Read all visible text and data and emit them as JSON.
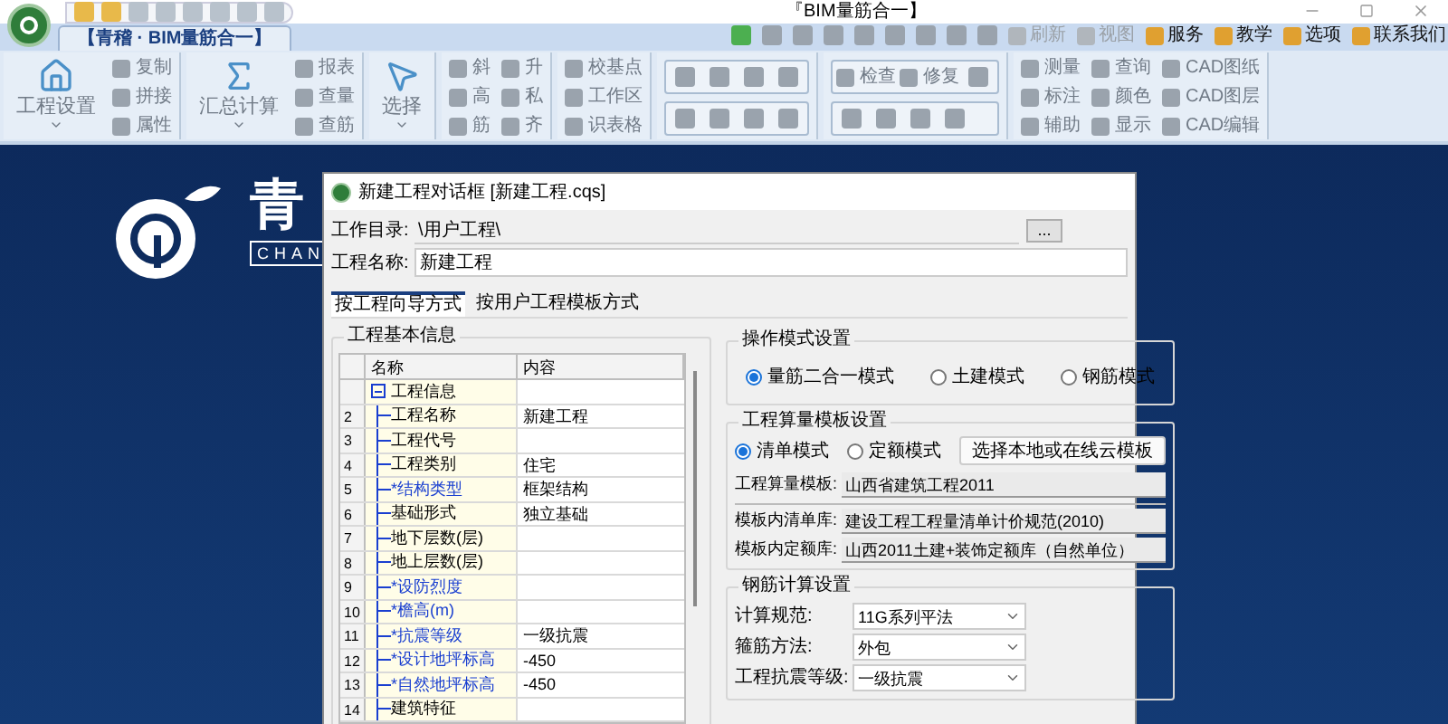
{
  "window": {
    "title": "『BIM量筋合一】"
  },
  "tabs": [
    {
      "label": "【青稽 · BIM量筋合一】",
      "selected": true
    }
  ],
  "toolbar": [
    {
      "label": "刷新",
      "disabled": true
    },
    {
      "label": "视图",
      "disabled": true
    },
    {
      "label": "服务",
      "disabled": false
    },
    {
      "label": "教学",
      "disabled": false
    },
    {
      "label": "选项",
      "disabled": false
    },
    {
      "label": "联系我们",
      "disabled": false
    }
  ],
  "ribbon": [
    {
      "kind": "columns",
      "columns": [
        [
          {
            "kind": "large",
            "label": "工程设置"
          }
        ],
        [
          {
            "kind": "small",
            "label": "复制"
          },
          {
            "kind": "small",
            "label": "拼接"
          },
          {
            "kind": "small",
            "label": "属性"
          }
        ]
      ]
    },
    {
      "kind": "columns",
      "columns": [
        [
          {
            "kind": "large",
            "label": "汇总计算"
          }
        ],
        [
          {
            "kind": "small",
            "label": "报表"
          },
          {
            "kind": "small",
            "label": "查量"
          },
          {
            "kind": "small",
            "label": "查筋"
          }
        ]
      ]
    },
    {
      "kind": "columns",
      "columns": [
        [
          {
            "kind": "large",
            "label": "选择"
          }
        ]
      ]
    },
    {
      "kind": "columns",
      "columns": [
        [
          {
            "kind": "small",
            "label": "斜"
          },
          {
            "kind": "small",
            "label": "高"
          },
          {
            "kind": "small",
            "label": "筋"
          }
        ],
        [
          {
            "kind": "small",
            "label": "升"
          },
          {
            "kind": "small",
            "label": "私"
          },
          {
            "kind": "small",
            "label": "齐"
          }
        ]
      ]
    },
    {
      "kind": "columns",
      "columns": [
        [
          {
            "kind": "small",
            "label": "校基点"
          },
          {
            "kind": "small",
            "label": "工作区"
          },
          {
            "kind": "small",
            "label": "识表格"
          }
        ]
      ]
    },
    {
      "kind": "rows",
      "rows": [
        [
          {
            "kind": "icon"
          },
          {
            "kind": "icon"
          },
          {
            "kind": "icon"
          },
          {
            "kind": "icon"
          }
        ],
        [
          {
            "kind": "icon"
          },
          {
            "kind": "icon"
          },
          {
            "kind": "icon"
          },
          {
            "kind": "icon"
          }
        ]
      ]
    },
    {
      "kind": "rows",
      "rows": [
        [
          {
            "kind": "small",
            "label": "检查"
          },
          {
            "kind": "small",
            "label": "修复"
          },
          {
            "kind": "icon"
          }
        ],
        [
          {
            "kind": "icon"
          },
          {
            "kind": "icon"
          },
          {
            "kind": "icon"
          },
          {
            "kind": "icon"
          }
        ]
      ]
    },
    {
      "kind": "columns",
      "columns": [
        [
          {
            "kind": "small",
            "label": "测量"
          },
          {
            "kind": "small",
            "label": "标注"
          },
          {
            "kind": "small",
            "label": "辅助"
          }
        ],
        [
          {
            "kind": "small",
            "label": "查询"
          },
          {
            "kind": "small",
            "label": "颜色"
          },
          {
            "kind": "small",
            "label": "显示"
          }
        ],
        [
          {
            "kind": "small",
            "label": "CAD图纸"
          },
          {
            "kind": "small",
            "label": "CAD图层"
          },
          {
            "kind": "small",
            "label": "CAD编辑"
          }
        ]
      ]
    }
  ],
  "background": {
    "logo_text": "青",
    "logo_subtext": "CHAN"
  },
  "dialog": {
    "title": "新建工程对话框 [新建工程.cqs]",
    "work_dir": {
      "label": "工作目录:",
      "value": "\\用户工程\\",
      "button": "..."
    },
    "project_name": {
      "label": "工程名称:",
      "value": "新建工程"
    },
    "tabs": [
      {
        "label": "按工程向导方式",
        "selected": true
      },
      {
        "label": "按用户工程模板方式",
        "selected": false
      }
    ],
    "basic_info": {
      "title": "工程基本信息",
      "columns": [
        "名称",
        "内容"
      ],
      "rows": [
        {
          "kind": "group",
          "num": "",
          "name": "工程信息",
          "expanded": true
        },
        {
          "kind": "field",
          "num": "2",
          "name": "工程名称",
          "value": "新建工程",
          "required": false
        },
        {
          "kind": "field",
          "num": "3",
          "name": "工程代号",
          "required": false
        },
        {
          "kind": "field",
          "num": "4",
          "name": "工程类别",
          "value": "住宅",
          "required": false
        },
        {
          "kind": "field",
          "num": "5",
          "name": "*结构类型",
          "value": "框架结构",
          "required": true
        },
        {
          "kind": "field",
          "num": "6",
          "name": "基础形式",
          "value": "独立基础",
          "required": false
        },
        {
          "kind": "field",
          "num": "7",
          "name": "地下层数(层)",
          "required": false
        },
        {
          "kind": "field",
          "num": "8",
          "name": "地上层数(层)",
          "required": false
        },
        {
          "kind": "field",
          "num": "9",
          "name": "*设防烈度",
          "required": true
        },
        {
          "kind": "field",
          "num": "10",
          "name": "*檐高(m)",
          "required": true
        },
        {
          "kind": "field",
          "num": "11",
          "name": "*抗震等级",
          "value": "一级抗震",
          "required": true
        },
        {
          "kind": "field",
          "num": "12",
          "name": "*设计地坪标高",
          "value": "-450",
          "required": true
        },
        {
          "kind": "field",
          "num": "13",
          "name": "*自然地坪标高",
          "value": "-450",
          "required": true
        },
        {
          "kind": "field",
          "num": "14",
          "name": "建筑特征",
          "required": false
        }
      ]
    },
    "mode": {
      "title": "操作模式设置",
      "options": [
        {
          "label": "量筋二合一模式",
          "selected": true
        },
        {
          "label": "土建模式",
          "selected": false
        },
        {
          "label": "钢筋模式",
          "selected": false
        }
      ]
    },
    "template": {
      "title": "工程算量模板设置",
      "options": [
        {
          "label": "清单模式",
          "selected": true
        },
        {
          "label": "定额模式",
          "selected": false
        }
      ],
      "button": "选择本地或在线云模板",
      "fields": [
        {
          "label": "工程算量模板:",
          "value": "山西省建筑工程2011"
        },
        {
          "label": "模板内清单库:",
          "value": "建设工程工程量清单计价规范(2010)"
        },
        {
          "label": "模板内定额库:",
          "value": "山西2011土建+装饰定额库（自然单位）"
        }
      ]
    },
    "rebar": {
      "title": "钢筋计算设置",
      "fields": [
        {
          "label": "计算规范:",
          "value": "11G系列平法"
        },
        {
          "label": "箍筋方法:",
          "value": "外包"
        },
        {
          "label": "工程抗震等级:",
          "value": "一级抗震"
        }
      ]
    }
  }
}
